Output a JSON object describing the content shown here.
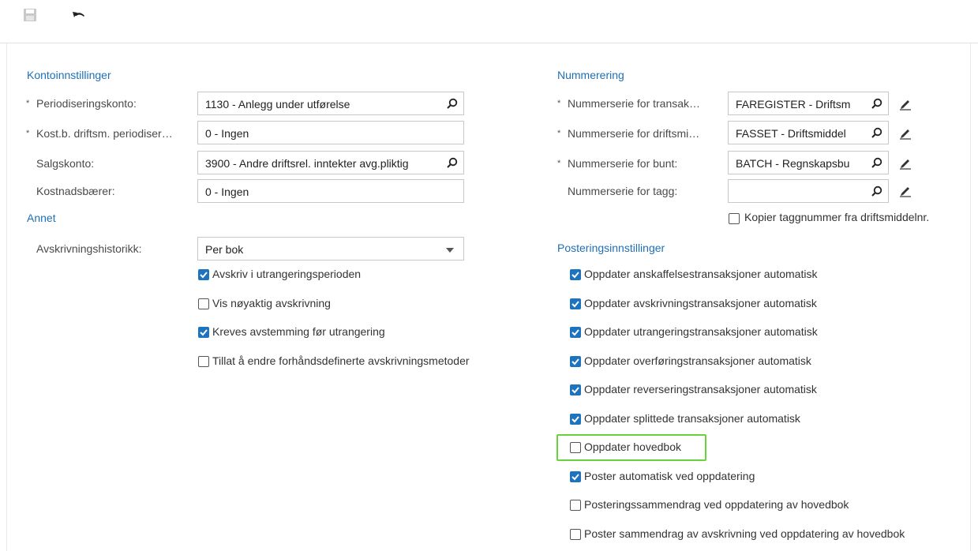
{
  "toolbar": {
    "save_icon": "save-icon",
    "undo_icon": "undo-icon"
  },
  "account": {
    "title": "Kontoinnstillinger",
    "required_mark": "*",
    "periodization_label": "Periodiseringskonto:",
    "periodization_value": "1130 - Anlegg under utførelse",
    "costcenter_label": "Kost.b. driftsm. periodiser…",
    "costcenter_value": "0 - Ingen",
    "sales_label": "Salgskonto:",
    "sales_value": "3900 - Andre driftsrel. inntekter avg.pliktig",
    "costbearer_label": "Kostnadsbærer:",
    "costbearer_value": "0 - Ingen"
  },
  "other": {
    "title": "Annet",
    "history_label": "Avskrivningshistorikk:",
    "history_value": "Per bok",
    "checkboxes": [
      {
        "label": "Avskriv i utrangeringsperioden",
        "checked": true
      },
      {
        "label": "Vis nøyaktig avskrivning",
        "checked": false
      },
      {
        "label": "Kreves avstemming før utrangering",
        "checked": true
      },
      {
        "label": "Tillat å endre forhåndsdefinerte avskrivningsmetoder",
        "checked": false
      }
    ]
  },
  "numbering": {
    "title": "Nummerering",
    "required_mark": "*",
    "transaction_label": "Nummerserie for transak…",
    "transaction_value": "FAREGISTER - Driftsm",
    "asset_label": "Nummerserie for driftsmi…",
    "asset_value": "FASSET - Driftsmiddel",
    "batch_label": "Nummerserie for bunt:",
    "batch_value": "BATCH - Regnskapsbu",
    "tag_label": "Nummerserie for tagg:",
    "tag_value": "",
    "copy_tag_label": "Kopier taggnummer fra driftsmiddelnr.",
    "copy_tag_checked": false
  },
  "posting": {
    "title": "Posteringsinnstillinger",
    "checkboxes": [
      {
        "label": "Oppdater anskaffelsestransaksjoner automatisk",
        "checked": true
      },
      {
        "label": "Oppdater avskrivningstransaksjoner automatisk",
        "checked": true
      },
      {
        "label": "Oppdater utrangeringstransaksjoner automatisk",
        "checked": true
      },
      {
        "label": "Oppdater overføringstransaksjoner automatisk",
        "checked": true
      },
      {
        "label": "Oppdater reverseringstransaksjoner automatisk",
        "checked": true
      },
      {
        "label": "Oppdater splittede transaksjoner automatisk",
        "checked": true
      },
      {
        "label": "Oppdater hovedbok",
        "checked": false
      },
      {
        "label": "Poster automatisk ved oppdatering",
        "checked": true
      },
      {
        "label": "Posteringssammendrag ved oppdatering av hovedbok",
        "checked": false
      },
      {
        "label": "Poster sammendrag av avskrivning ved oppdatering av hovedbok",
        "checked": false
      }
    ]
  },
  "colors": {
    "accent": "#1f6fb5",
    "checkbox": "#1e73be",
    "highlight": "#66d43a"
  }
}
